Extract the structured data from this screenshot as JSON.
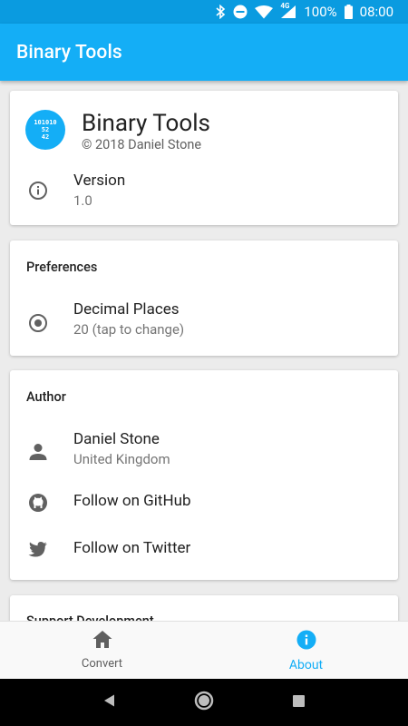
{
  "status_bar": {
    "network": "4G",
    "battery": "100%",
    "time": "08:00",
    "icons": [
      "bluetooth-icon",
      "do-not-disturb-icon",
      "wifi-icon",
      "cell-signal-icon",
      "battery-icon"
    ]
  },
  "app_bar": {
    "title": "Binary Tools"
  },
  "about_card": {
    "logo_lines": [
      "101010",
      "52",
      "42"
    ],
    "app_name": "Binary Tools",
    "copyright": "© 2018 Daniel Stone",
    "version_label": "Version",
    "version_value": "1.0",
    "version_icon": "info-outline-icon"
  },
  "preferences_card": {
    "header": "Preferences",
    "decimal_places_label": "Decimal Places",
    "decimal_places_value": "20 (tap to change)",
    "decimal_places_icon": "radio-button-icon"
  },
  "author_card": {
    "header": "Author",
    "name": "Daniel Stone",
    "location": "United Kingdom",
    "github": "Follow on GitHub",
    "twitter": "Follow on Twitter",
    "icons": [
      "person-icon",
      "github-icon",
      "twitter-icon"
    ]
  },
  "support_card": {
    "header": "Support Development"
  },
  "bottom_nav": {
    "items": [
      {
        "label": "Convert",
        "icon": "home-icon",
        "active": false
      },
      {
        "label": "About",
        "icon": "info-filled-icon",
        "active": true
      }
    ]
  },
  "colors": {
    "primary": "#14aef6",
    "status_bar": "#0a9be0",
    "background": "#ececec"
  }
}
